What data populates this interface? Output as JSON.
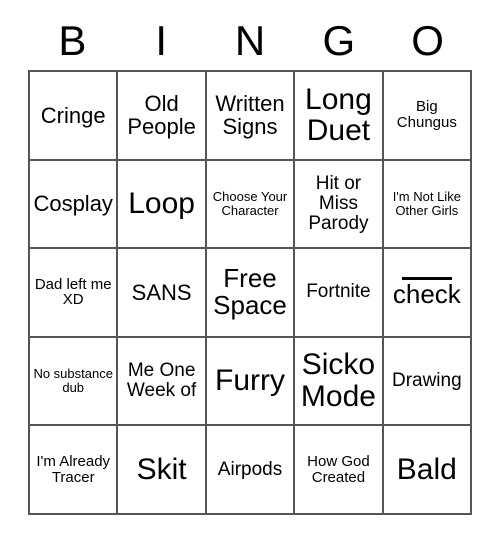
{
  "card": {
    "title_letters": [
      "B",
      "I",
      "N",
      "G",
      "O"
    ],
    "grid": {
      "rows": 5,
      "cols": 5,
      "border_color": "#555555",
      "background": "#ffffff",
      "text_color": "#000000"
    },
    "cells": [
      [
        {
          "text": "Cringe",
          "size": "t-lg"
        },
        {
          "text": "Old People",
          "size": "t-lg"
        },
        {
          "text": "Written Signs",
          "size": "t-lg"
        },
        {
          "text": "Long Duet",
          "size": "t-xxl"
        },
        {
          "text": "Big Chungus",
          "size": "t-sm"
        }
      ],
      [
        {
          "text": "Cosplay",
          "size": "t-lg"
        },
        {
          "text": "Loop",
          "size": "t-xxl"
        },
        {
          "text": "Choose Your Character",
          "size": "t-xs"
        },
        {
          "text": "Hit or Miss Parody",
          "size": "t-md"
        },
        {
          "text": "I'm Not Like Other Girls",
          "size": "t-xs"
        }
      ],
      [
        {
          "text": "Dad left me XD",
          "size": "t-sm"
        },
        {
          "text": "SANS",
          "size": "t-lg"
        },
        {
          "text": "Free Space",
          "size": "t-xl"
        },
        {
          "text": "Fortnite",
          "size": "t-md"
        },
        {
          "text": "check",
          "size": "t-xl",
          "rule_above": true
        }
      ],
      [
        {
          "text": "No substance dub",
          "size": "t-xs"
        },
        {
          "text": "Me One Week of",
          "size": "t-md"
        },
        {
          "text": "Furry",
          "size": "t-xxl"
        },
        {
          "text": "Sicko Mode",
          "size": "t-xxl"
        },
        {
          "text": "Drawing",
          "size": "t-md"
        }
      ],
      [
        {
          "text": "I'm Already Tracer",
          "size": "t-sm"
        },
        {
          "text": "Skit",
          "size": "t-xxl"
        },
        {
          "text": "Airpods",
          "size": "t-md"
        },
        {
          "text": "How God Created",
          "size": "t-sm"
        },
        {
          "text": "Bald",
          "size": "t-xxl"
        }
      ]
    ]
  }
}
